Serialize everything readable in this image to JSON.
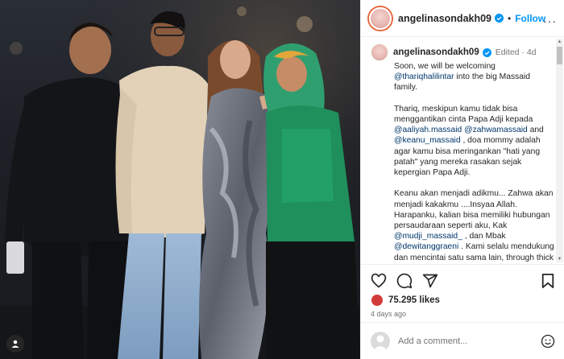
{
  "header": {
    "username": "angelinasondakh09",
    "follow_label": "Follow",
    "separator": "•",
    "more_label": "···"
  },
  "caption": {
    "username": "angelinasondakh09",
    "edited": "Edited · 4d",
    "p1_a": "Soon, we will be welcoming ",
    "p1_mention": "@thariqhalilintar",
    "p1_b": " into the big Massaid family.",
    "p2_a": "Thariq, meskipun kamu tidak bisa menggantikan cinta Papa Adji kepada ",
    "p2_m1": "@aaliyah.massaid",
    "p2_m2": "@zahwamassaid",
    "p2_and": " and ",
    "p2_m3": "@keanu_massaid",
    "p2_b": " , doa mommy adalah agar kamu bisa meringankan \"hati yang patah\" yang mereka rasakan sejak kepergian Papa Adji.",
    "p3_a": "Keanu akan menjadi adikmu... Zahwa akan menjadi kakakmu ....Insyaa Allah. Harapanku, kalian bisa memiliki hubungan persaudaraan seperti aku, Kak ",
    "p3_m1": "@mudji_massaid_",
    "p3_b": " , dan Mbak ",
    "p3_m2": "@dewitanggraeni",
    "p3_c": " . Kami selalu mendukung dan mencintai satu sama lain, through thick and thin."
  },
  "actions": {
    "likes": "75.295 likes",
    "time": "4 days ago"
  },
  "comment": {
    "placeholder": "Add a comment..."
  },
  "colors": {
    "accent": "#0095f6",
    "mention": "#00376b",
    "muted": "#737373",
    "green_outfit": "#1e9a6b"
  }
}
